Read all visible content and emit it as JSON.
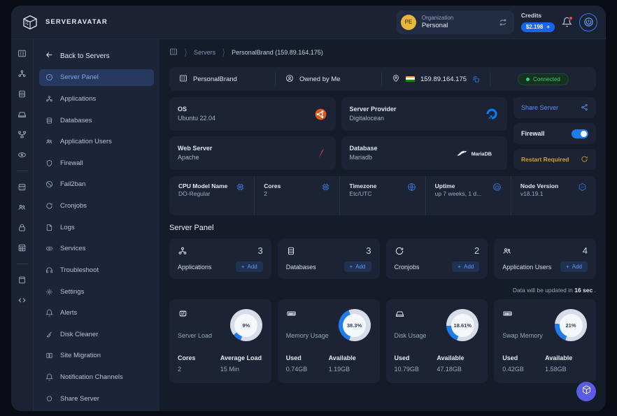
{
  "header": {
    "brand_name": "SERVERAVATAR",
    "brand_logo_icon": "server-cube-icon",
    "org": {
      "avatar_initials": "PE",
      "label": "Organization",
      "value": "Personal",
      "swap_icon": "swap-icon"
    },
    "credits": {
      "label": "Credits",
      "amount": "$2.198",
      "plus": "+"
    },
    "bell_icon": "bell-icon",
    "power_icon": "power-icon"
  },
  "rail": {
    "items": [
      {
        "icon": "servers-icon"
      },
      {
        "icon": "applications-icon"
      },
      {
        "icon": "databases-icon"
      },
      {
        "icon": "disk-icon"
      },
      {
        "icon": "network-icon"
      },
      {
        "icon": "services-icon"
      },
      {
        "icon": "calendar-icon"
      },
      {
        "icon": "users-icon"
      },
      {
        "icon": "lock-icon"
      },
      {
        "icon": "grid-icon"
      },
      {
        "icon": "book-icon"
      },
      {
        "icon": "code-icon"
      }
    ]
  },
  "sidebar": {
    "back_label": "Back to Servers",
    "back_icon": "arrow-left-icon",
    "items": [
      {
        "label": "Server Panel",
        "icon": "gauge-icon",
        "active": true
      },
      {
        "label": "Applications",
        "icon": "applications-icon",
        "active": false
      },
      {
        "label": "Databases",
        "icon": "database-icon",
        "active": false
      },
      {
        "label": "Application Users",
        "icon": "users-icon",
        "active": false
      },
      {
        "label": "Firewall",
        "icon": "shield-icon",
        "active": false
      },
      {
        "label": "Fail2ban",
        "icon": "ban-icon",
        "active": false
      },
      {
        "label": "Cronjobs",
        "icon": "refresh-icon",
        "active": false
      },
      {
        "label": "Logs",
        "icon": "file-icon",
        "active": false
      },
      {
        "label": "Services",
        "icon": "services-icon",
        "active": false
      },
      {
        "label": "Troubleshoot",
        "icon": "headset-icon",
        "active": false
      },
      {
        "label": "Settings",
        "icon": "gear-icon",
        "active": false
      },
      {
        "label": "Alerts",
        "icon": "bell-icon",
        "active": false
      },
      {
        "label": "Disk Cleaner",
        "icon": "broom-icon",
        "active": false
      },
      {
        "label": "Site Migration",
        "icon": "migration-icon",
        "active": false
      },
      {
        "label": "Notification Channels",
        "icon": "bell-icon",
        "active": false
      },
      {
        "label": "Share Server",
        "icon": "share-icon",
        "active": false
      }
    ]
  },
  "breadcrumb": {
    "home_icon": "servers-icon",
    "items": [
      "Servers",
      "PersonalBrand (159.89.164.175)"
    ]
  },
  "server_strip": {
    "name": "PersonalBrand",
    "name_icon": "server-icon",
    "owner": "Owned by Me",
    "owner_icon": "user-circle-icon",
    "location_icon": "pin-icon",
    "ip": "159.89.164.175",
    "copy_icon": "copy-icon",
    "status": "Connected"
  },
  "info_cards": [
    {
      "label": "OS",
      "value": "Ubuntu 22.04",
      "logo": "ubuntu-logo"
    },
    {
      "label": "Server Provider",
      "value": "Digitalocean",
      "logo": "digitalocean-logo"
    },
    {
      "label": "Web Server",
      "value": "Apache",
      "logo": "apache-logo"
    },
    {
      "label": "Database",
      "value": "Mariadb",
      "logo": "mariadb-logo"
    }
  ],
  "side_actions": {
    "share_label": "Share Server",
    "share_icon": "share-icon",
    "firewall_label": "Firewall",
    "firewall_enabled": true,
    "restart_label": "Restart Required",
    "restart_icon": "refresh-icon"
  },
  "specs": [
    {
      "label": "CPU Model Name",
      "value": "DO-Regular",
      "icon": "cpu-icon"
    },
    {
      "label": "Cores",
      "value": "2",
      "icon": "cpu-icon"
    },
    {
      "label": "Timezone",
      "value": "Etc/UTC",
      "icon": "globe-icon"
    },
    {
      "label": "Uptime",
      "value": "up 7 weeks, 1 d...",
      "icon": "power-icon"
    },
    {
      "label": "Node Version",
      "value": "v18.19.1",
      "icon": "js-icon"
    }
  ],
  "panel": {
    "title": "Server Panel",
    "add_label": "Add",
    "add_icon": "plus-icon",
    "cards": [
      {
        "label": "Applications",
        "count": "3",
        "icon": "applications-icon"
      },
      {
        "label": "Databases",
        "count": "3",
        "icon": "database-icon"
      },
      {
        "label": "Cronjobs",
        "count": "2",
        "icon": "refresh-icon"
      },
      {
        "label": "Application Users",
        "count": "4",
        "icon": "users-icon"
      }
    ]
  },
  "refresh_note": {
    "prefix": "Data will be updated in ",
    "seconds": "16 sec",
    "suffix": " ."
  },
  "metrics": [
    {
      "name": "Server Load",
      "icon": "cpu-icon",
      "percent_text": "9%",
      "percent": 9,
      "col1_head": "Cores",
      "col1_value": "2",
      "col2_head": "Average Load",
      "col2_value": "15 Min"
    },
    {
      "name": "Memory Usage",
      "icon": "memory-icon",
      "percent_text": "38.3%",
      "percent": 38.3,
      "col1_head": "Used",
      "col1_value": "0.74GB",
      "col2_head": "Available",
      "col2_value": "1.19GB"
    },
    {
      "name": "Disk Usage",
      "icon": "disk-icon",
      "percent_text": "18.61%",
      "percent": 18.61,
      "col1_head": "Used",
      "col1_value": "10.79GB",
      "col2_head": "Available",
      "col2_value": "47.18GB"
    },
    {
      "name": "Swap Memory",
      "icon": "memory-icon",
      "percent_text": "21%",
      "percent": 21,
      "col1_head": "Used",
      "col1_value": "0.42GB",
      "col2_head": "Available",
      "col2_value": "1.58GB"
    }
  ],
  "fab": {
    "icon": "package-icon"
  },
  "colors": {
    "accent": "#1f7ceb",
    "gauge_arc": "#1f7ceb",
    "gauge_track": "#d7dde8",
    "warning": "#d2a12a",
    "success": "#35d07f"
  }
}
